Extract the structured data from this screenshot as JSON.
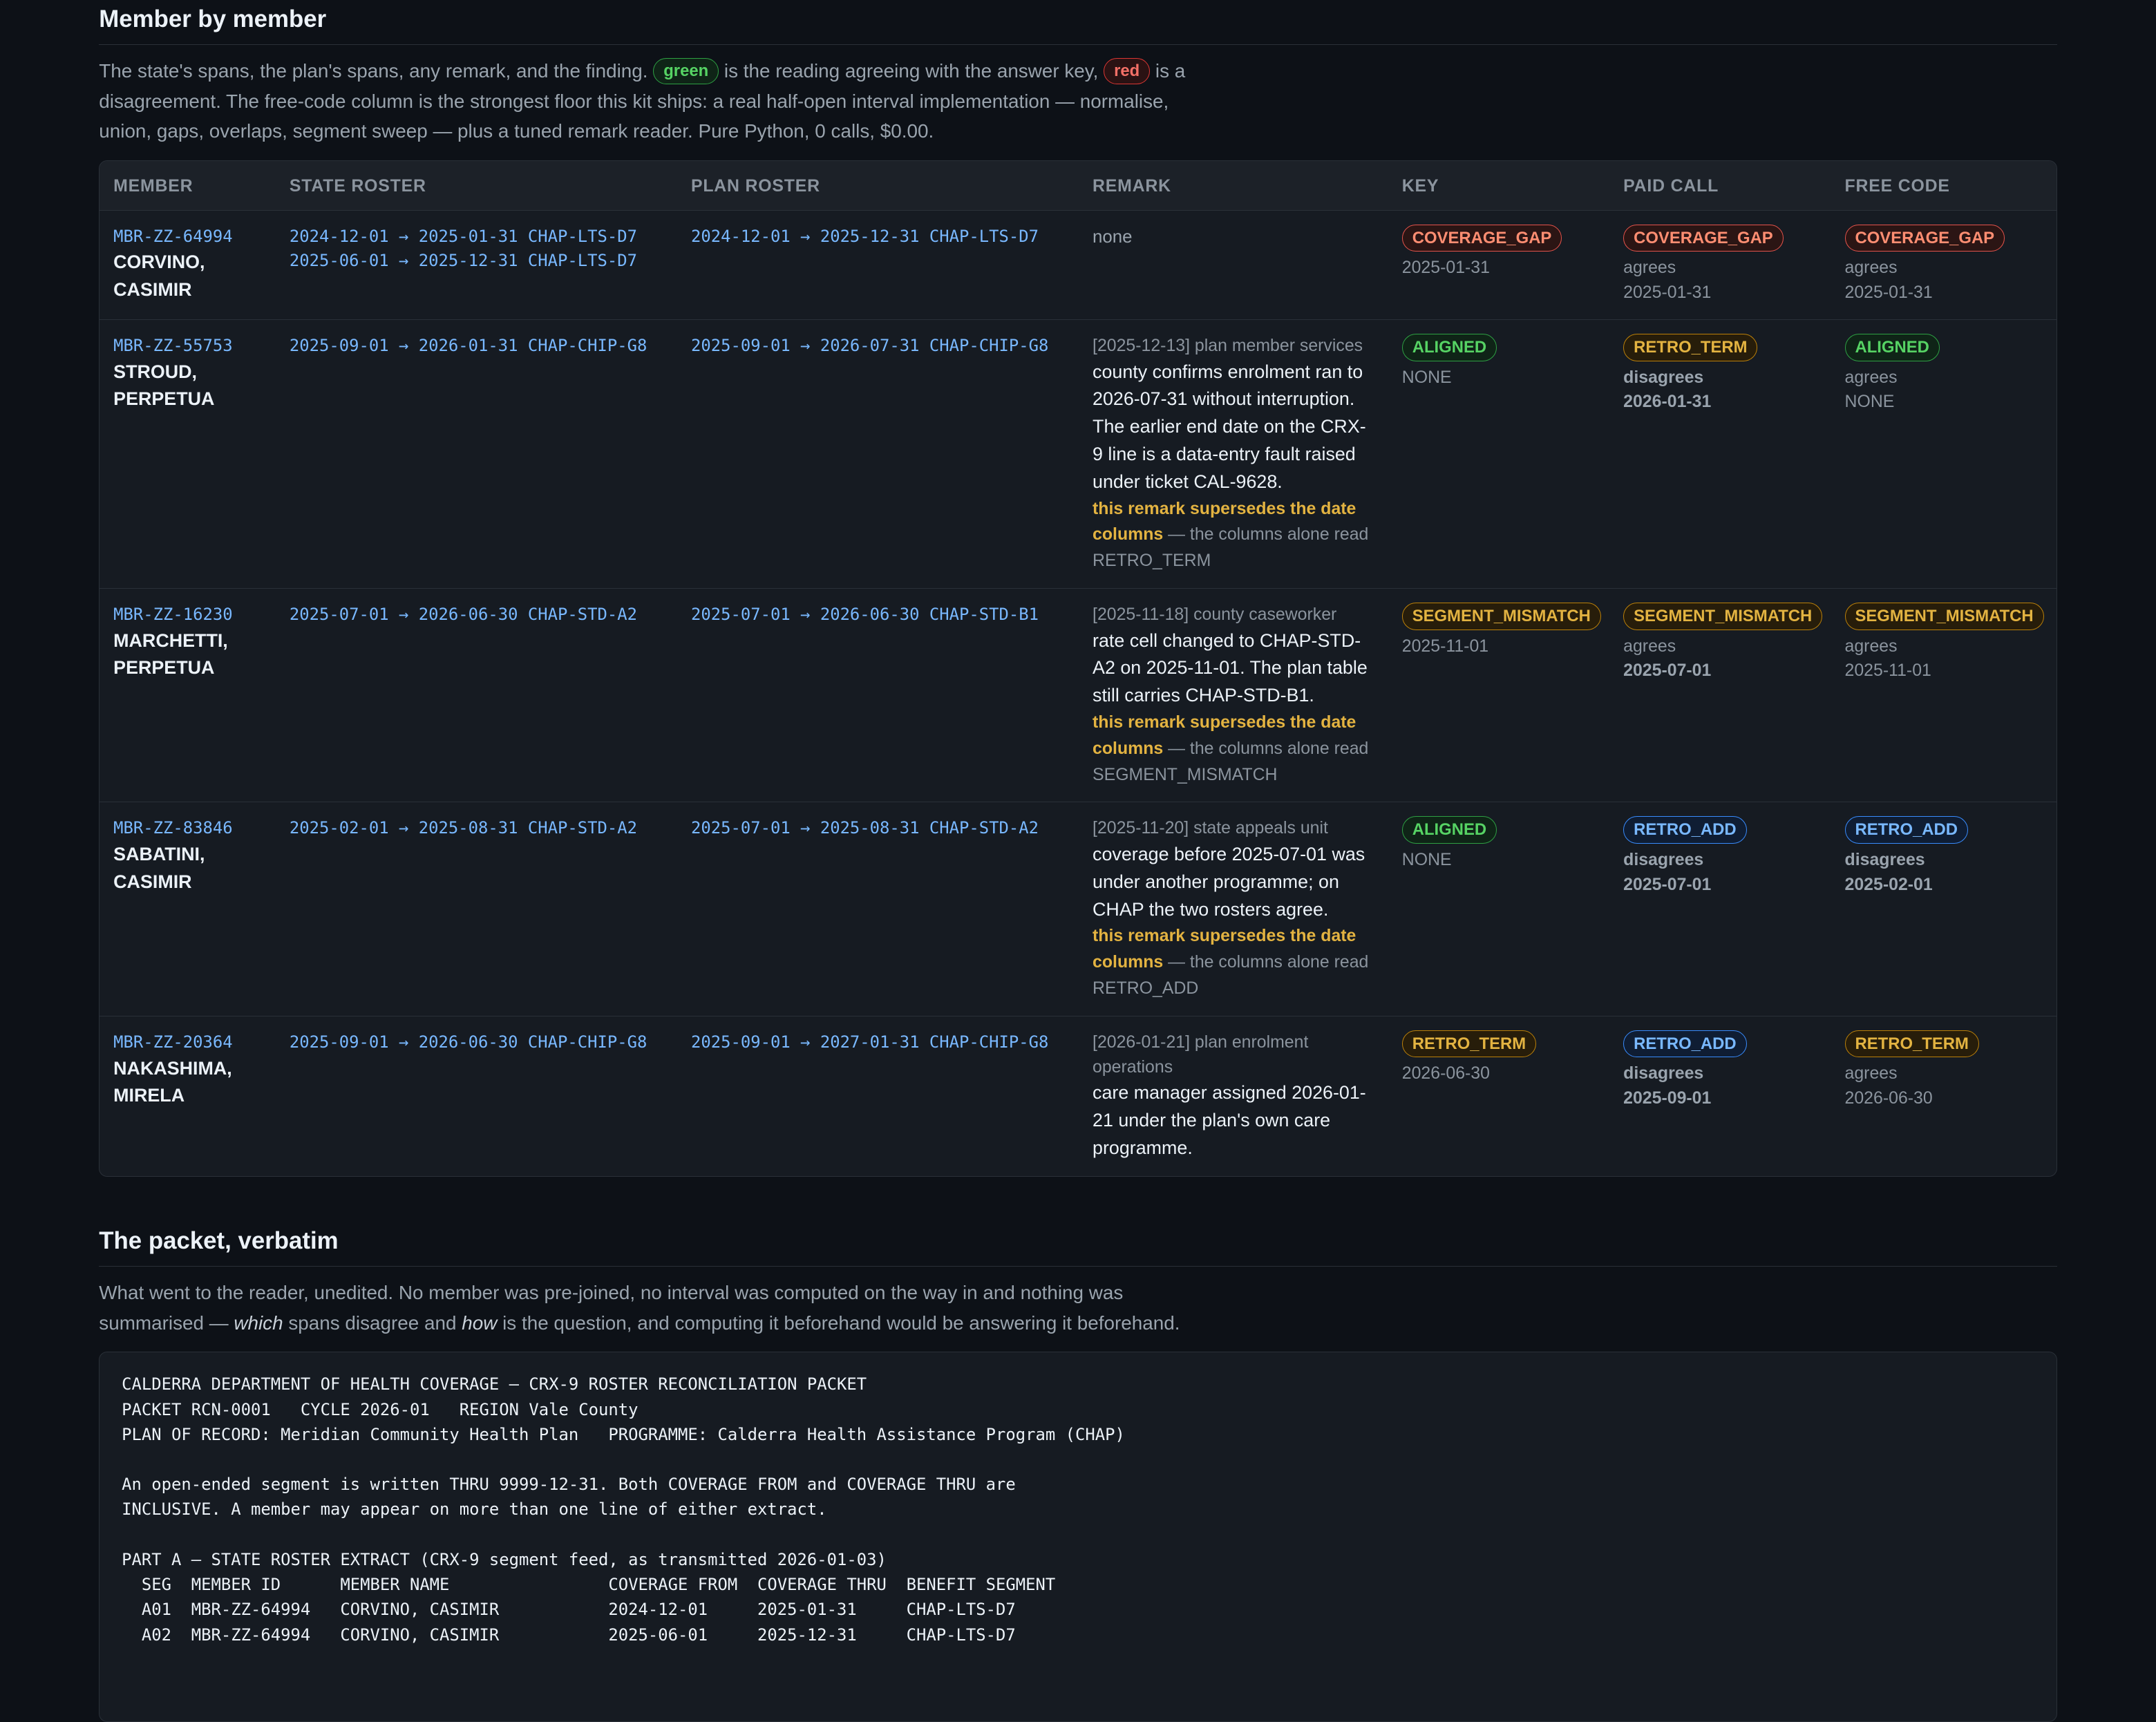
{
  "section1": {
    "title": "Member by member",
    "lede_a": "The state's spans, the plan's spans, any remark, and the finding.",
    "chip_green": "green",
    "lede_b": "is the reading agreeing with the answer key,",
    "chip_red": "red",
    "lede_c": "is a disagreement. The free-code column is the strongest floor this kit ships: a real half-open interval implementation — normalise, union, gaps, overlaps, segment sweep — plus a tuned remark reader. Pure Python, 0 calls, $0.00."
  },
  "table": {
    "headers": [
      "MEMBER",
      "STATE ROSTER",
      "PLAN ROSTER",
      "REMARK",
      "KEY",
      "PAID CALL",
      "FREE CODE"
    ],
    "rows": [
      {
        "id": "MBR-ZZ-64994",
        "name": "CORVINO, CASIMIR",
        "state": [
          "2024-12-01 → 2025-01-31 CHAP-LTS-D7",
          "2025-06-01 → 2025-12-31 CHAP-LTS-D7"
        ],
        "plan": [
          "2024-12-01 → 2025-12-31 CHAP-LTS-D7"
        ],
        "remark_none": "none",
        "key": {
          "label": "COVERAGE_GAP",
          "sub": "2025-01-31"
        },
        "paid": {
          "label": "COVERAGE_GAP",
          "verdict": "agrees",
          "sub": "2025-01-31"
        },
        "free": {
          "label": "COVERAGE_GAP",
          "verdict": "agrees",
          "sub": "2025-01-31"
        }
      },
      {
        "id": "MBR-ZZ-55753",
        "name": "STROUD, PERPETUA",
        "state": [
          "2025-09-01 → 2026-01-31 CHAP-CHIP-G8"
        ],
        "plan": [
          "2025-09-01 → 2026-07-31 CHAP-CHIP-G8"
        ],
        "remark": {
          "meta": "[2025-12-13] plan member services",
          "body": "county confirms enrolment ran to 2026-07-31 without interruption. The earlier end date on the CRX-9 line is a data-entry fault raised under ticket CAL-9628.",
          "note_bold": "this remark supersedes the date columns",
          "note_rest": " — the columns alone read RETRO_TERM"
        },
        "key": {
          "label": "ALIGNED",
          "sub": "NONE"
        },
        "paid": {
          "label": "RETRO_TERM",
          "verdict": "disagrees",
          "sub": "2026-01-31"
        },
        "free": {
          "label": "ALIGNED",
          "verdict": "agrees",
          "sub": "NONE"
        }
      },
      {
        "id": "MBR-ZZ-16230",
        "name": "MARCHETTI, PERPETUA",
        "state": [
          "2025-07-01 → 2026-06-30 CHAP-STD-A2"
        ],
        "plan": [
          "2025-07-01 → 2026-06-30 CHAP-STD-B1"
        ],
        "remark": {
          "meta": "[2025-11-18] county caseworker",
          "body": "rate cell changed to CHAP-STD-A2 on 2025-11-01. The plan table still carries CHAP-STD-B1.",
          "note_bold": "this remark supersedes the date columns",
          "note_rest": " — the columns alone read SEGMENT_MISMATCH"
        },
        "key": {
          "label": "SEGMENT_MISMATCH",
          "sub": "2025-11-01"
        },
        "paid": {
          "label": "SEGMENT_MISMATCH",
          "verdict": "agrees",
          "sub": "2025-07-01"
        },
        "free": {
          "label": "SEGMENT_MISMATCH",
          "verdict": "agrees",
          "sub": "2025-11-01"
        }
      },
      {
        "id": "MBR-ZZ-83846",
        "name": "SABATINI, CASIMIR",
        "state": [
          "2025-02-01 → 2025-08-31 CHAP-STD-A2"
        ],
        "plan": [
          "2025-07-01 → 2025-08-31 CHAP-STD-A2"
        ],
        "remark": {
          "meta": "[2025-11-20] state appeals unit",
          "body": "coverage before 2025-07-01 was under another programme; on CHAP the two rosters agree.",
          "note_bold": "this remark supersedes the date columns",
          "note_rest": " — the columns alone read RETRO_ADD"
        },
        "key": {
          "label": "ALIGNED",
          "sub": "NONE"
        },
        "paid": {
          "label": "RETRO_ADD",
          "verdict": "disagrees",
          "sub": "2025-07-01"
        },
        "free": {
          "label": "RETRO_ADD",
          "verdict": "disagrees",
          "sub": "2025-02-01"
        }
      },
      {
        "id": "MBR-ZZ-20364",
        "name": "NAKASHIMA, MIRELA",
        "state": [
          "2025-09-01 → 2026-06-30 CHAP-CHIP-G8"
        ],
        "plan": [
          "2025-09-01 → 2027-01-31 CHAP-CHIP-G8"
        ],
        "remark": {
          "meta": "[2026-01-21] plan enrolment operations",
          "body": "care manager assigned 2026-01-21 under the plan's own care programme.",
          "note_bold": "",
          "note_rest": ""
        },
        "key": {
          "label": "RETRO_TERM",
          "sub": "2026-06-30"
        },
        "paid": {
          "label": "RETRO_ADD",
          "verdict": "disagrees",
          "sub": "2025-09-01"
        },
        "free": {
          "label": "RETRO_TERM",
          "verdict": "agrees",
          "sub": "2026-06-30"
        }
      }
    ]
  },
  "section2": {
    "title": "The packet, verbatim",
    "lede_a": "What went to the reader, unedited. No member was pre-joined, no interval was computed on the way in and nothing was summarised —",
    "em1": "which",
    "lede_b": "spans disagree and",
    "em2": "how",
    "lede_c": "is the question, and computing it beforehand would be answering it beforehand."
  },
  "packet": {
    "lines": [
      "CALDERRA DEPARTMENT OF HEALTH COVERAGE — CRX-9 ROSTER RECONCILIATION PACKET",
      "PACKET RCN-0001   CYCLE 2026-01   REGION Vale County",
      "PLAN OF RECORD: Meridian Community Health Plan   PROGRAMME: Calderra Health Assistance Program (CHAP)",
      "",
      "An open-ended segment is written THRU 9999-12-31. Both COVERAGE FROM and COVERAGE THRU are",
      "INCLUSIVE. A member may appear on more than one line of either extract.",
      "",
      "PART A — STATE ROSTER EXTRACT (CRX-9 segment feed, as transmitted 2026-01-03)",
      "  SEG  MEMBER ID      MEMBER NAME                COVERAGE FROM  COVERAGE THRU  BENEFIT SEGMENT",
      "  A01  MBR-ZZ-64994   CORVINO, CASIMIR           2024-12-01     2025-01-31     CHAP-LTS-D7",
      "  A02  MBR-ZZ-64994   CORVINO, CASIMIR           2025-06-01     2025-12-31     CHAP-LTS-D7"
    ]
  },
  "colors": {
    "background": "#0d1117",
    "panel": "#161b22",
    "link_blue": "#79b8ff",
    "aligned_green": "#56d364",
    "gap_red": "#ff8e72",
    "retro_amber": "#e3b341"
  }
}
